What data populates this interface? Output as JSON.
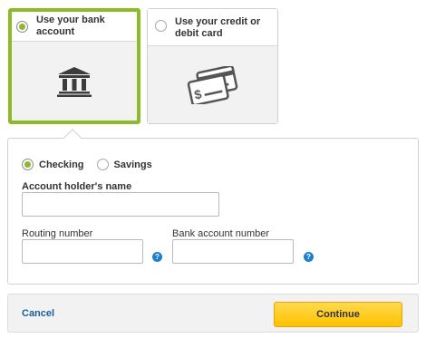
{
  "payment_methods": {
    "bank": {
      "label": "Use your bank account",
      "selected": true,
      "icon": "bank-building-icon"
    },
    "credit": {
      "label_line1": "Use your credit or",
      "label_line2": "debit card",
      "selected": false,
      "icon": "credit-cards-icon"
    }
  },
  "account_type": {
    "checking": {
      "label": "Checking",
      "selected": true
    },
    "savings": {
      "label": "Savings",
      "selected": false
    }
  },
  "fields": {
    "holder_name": {
      "label": "Account holder's name",
      "value": ""
    },
    "routing": {
      "label": "Routing number",
      "value": "",
      "help": "?"
    },
    "account_number": {
      "label": "Bank account number",
      "value": "",
      "help": "?"
    }
  },
  "footer": {
    "cancel": "Cancel",
    "continue": "Continue"
  },
  "colors": {
    "accent_green": "#8dba27",
    "link_blue": "#1a5e9a",
    "help_blue": "#1f7fd0",
    "button_yellow": "#ffc200"
  }
}
